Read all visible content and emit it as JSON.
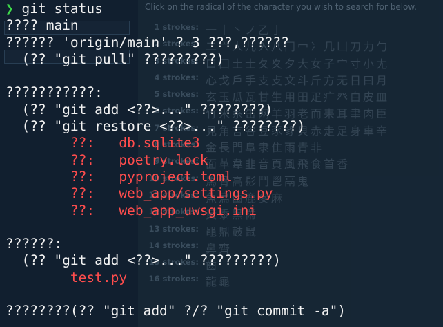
{
  "background_page": {
    "instruction": "Click on the radical of the character you wish to search for below.",
    "stroke_rows": [
      {
        "label": "1 strokes:",
        "radicals": "一丨丶ノ乙亅"
      },
      {
        "label": "2 strokes:",
        "radicals": "二亠人儿入八冂冖冫几凵刀力勹"
      },
      {
        "label": "3 strokes:",
        "radicals": "口囗土士夂夊夕大女子宀寸小尢"
      },
      {
        "label": "4 strokes:",
        "radicals": "心戈戶手支攴文斗斤方无日曰月"
      },
      {
        "label": "5 strokes:",
        "radicals": "玄玉瓜瓦甘生用田疋疒癶白皮皿"
      },
      {
        "label": "6 strokes:",
        "radicals": "竹米糸缶网羊羽老而耒耳聿肉臣"
      },
      {
        "label": "7 strokes:",
        "radicals": "見角言谷豆豕豸貝赤走足身車辛"
      },
      {
        "label": "8 strokes:",
        "radicals": "金長門阜隶隹雨青非"
      },
      {
        "label": "9 strokes:",
        "radicals": "面革韋韭音頁風飛食首香"
      },
      {
        "label": "10 strokes:",
        "radicals": "馬骨高髟鬥鬯鬲鬼"
      },
      {
        "label": "11 strokes:",
        "radicals": "魚鳥鹵鹿麥麻"
      },
      {
        "label": "12 strokes:",
        "radicals": "黃黍黑黹"
      },
      {
        "label": "13 strokes:",
        "radicals": "黽鼎鼓鼠"
      },
      {
        "label": "14 strokes:",
        "radicals": "鼻齊"
      },
      {
        "label": "15 strokes:",
        "radicals": "齒"
      },
      {
        "label": "16 strokes:",
        "radicals": "龍龜"
      }
    ]
  },
  "terminal": {
    "prompt_symbol": "❯",
    "command": " git status",
    "lines": [
      "???? main",
      "?????? 'origin/main' ? 3 ???,??????",
      "  (?? \"git pull\" ?????????)",
      "",
      "???????????:",
      "  (?? \"git add <??>...\" ????????)",
      "  (?? \"git restore <??>...\" ????????)"
    ],
    "modified": [
      {
        "status": "??:",
        "file": "db.sqlite3"
      },
      {
        "status": "??:",
        "file": "poetry.lock"
      },
      {
        "status": "??:",
        "file": "pyproject.toml"
      },
      {
        "status": "??:",
        "file": "web_app/settings.py"
      },
      {
        "status": "??:",
        "file": "web_app_uwsgi.ini"
      }
    ],
    "untracked_header": "??????:",
    "untracked_hint": "  (?? \"git add <??>...\" ?????????)",
    "untracked_files": [
      "test.py"
    ],
    "footer": "????????(?? \"git add\" ?/? \"git commit -a\")"
  }
}
